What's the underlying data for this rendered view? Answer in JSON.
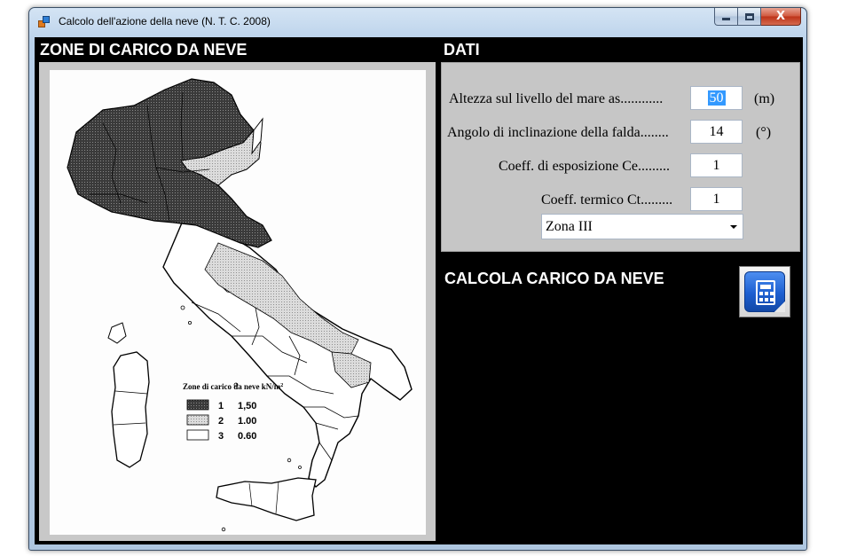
{
  "window": {
    "title": "Calcolo dell'azione della neve (N. T. C. 2008)",
    "controls": [
      "minimize",
      "maximize",
      "close"
    ],
    "close_glyph": "X"
  },
  "map_section": {
    "header": "ZONE DI CARICO DA NEVE",
    "legend": {
      "title": "Zone di carico da neve kN/m",
      "title_sup": "2",
      "items": [
        {
          "zone": "1",
          "value": "1,50",
          "fill": "#4a4a4a"
        },
        {
          "zone": "2",
          "value": "1.00",
          "fill": "#cfcfcf"
        },
        {
          "zone": "3",
          "value": "0.60",
          "fill": "#ffffff"
        }
      ]
    },
    "zone_colors": {
      "zone1": "#3f3f3f",
      "zone2": "#cdcdcd",
      "zone3": "#ffffff"
    }
  },
  "dati": {
    "header": "DATI",
    "altitude": {
      "label": "Altezza sul livello del mare as............",
      "value": "50",
      "unit": "(m)"
    },
    "slope_angle": {
      "label": "Angolo di inclinazione della  falda........",
      "value": "14",
      "unit": "(°)"
    },
    "exposure_coeff": {
      "label": "Coeff.  di esposizione Ce.........",
      "value": "1"
    },
    "thermal_coeff": {
      "label": "Coeff. termico Ct.........",
      "value": "1"
    },
    "zone_select": {
      "value": "Zona III"
    }
  },
  "calculate": {
    "label": "CALCOLA CARICO DA NEVE",
    "icon": "calculator-icon",
    "accent": "#1d5fd0"
  }
}
